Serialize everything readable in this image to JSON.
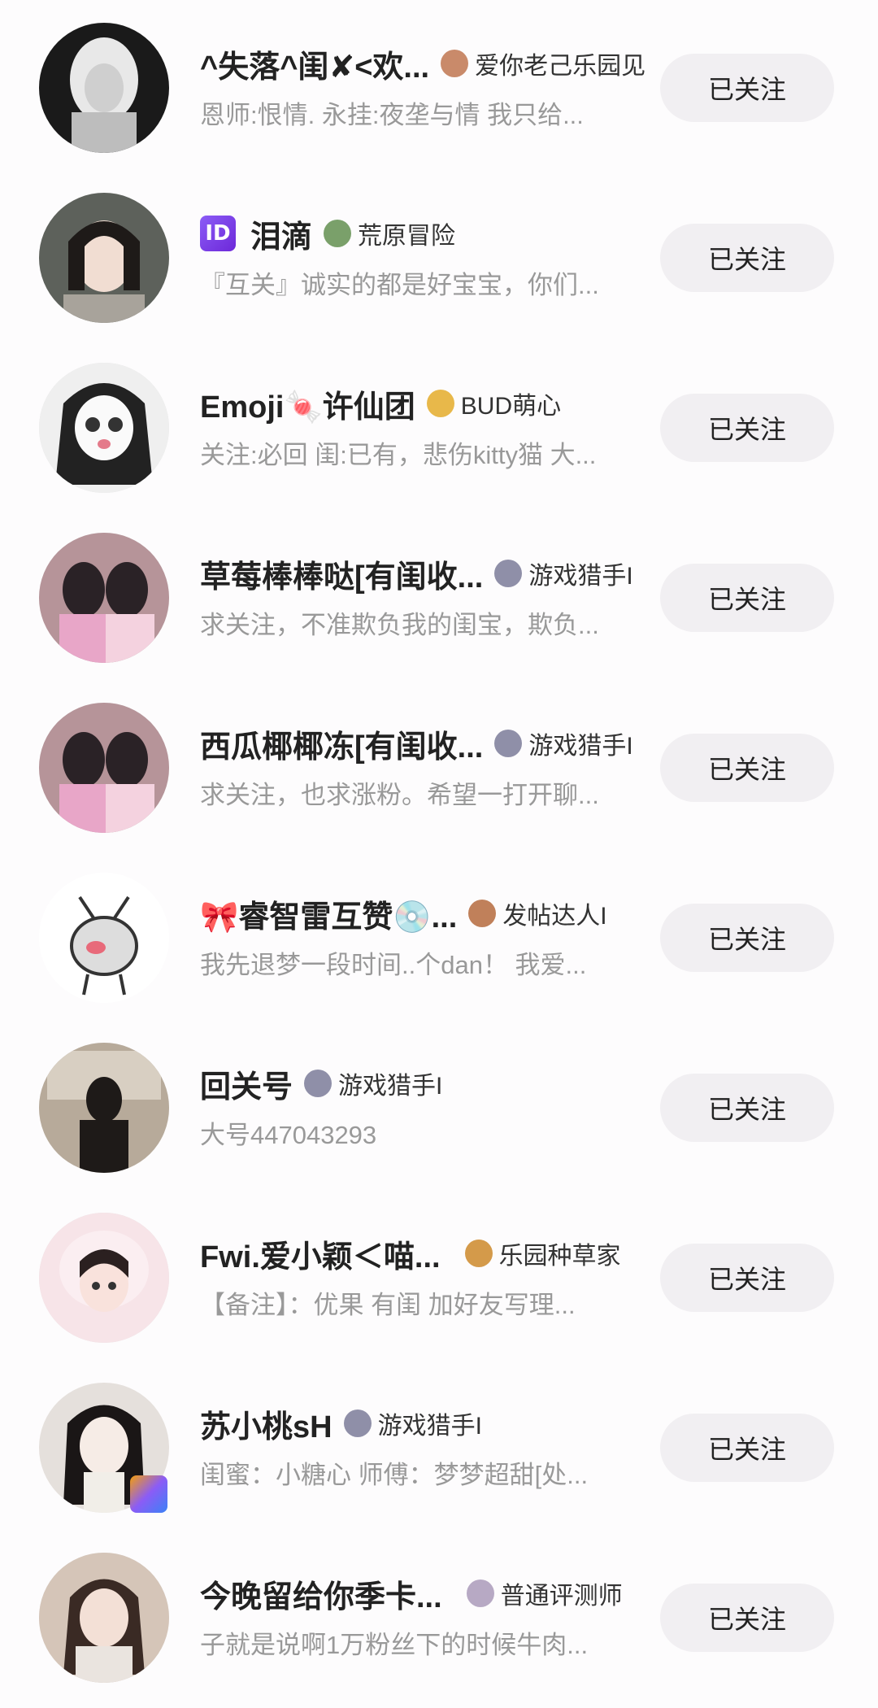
{
  "rows": [
    {
      "name": "^失落^闺✘<欢...",
      "title": "爱你老己乐园见",
      "bio": "恩师:恨情. 永挂:夜垄与情 我只给...",
      "button": "已关注",
      "title_icon": "#c98a6a",
      "avatar": "#2b2b2b"
    },
    {
      "name": "泪滴",
      "prefix": "ID",
      "title": "荒原冒险",
      "bio": "『互关』诚实的都是好宝宝，你们...",
      "button": "已关注",
      "title_icon": "#7aa06a",
      "avatar": "#6b6e68"
    },
    {
      "name": "Emoji🍬许仙团",
      "title": "BUD萌心",
      "bio": "关注:必回 闺:已有，悲伤kitty猫 大...",
      "button": "已关注",
      "title_icon": "#e8b84a",
      "avatar": "#e6e6e6"
    },
    {
      "name": "草莓棒棒哒[有闺收...",
      "title": "游戏猎手I",
      "bio": "求关注，不准欺负我的闺宝，欺负...",
      "button": "已关注",
      "title_icon": "#8f8fa8",
      "avatar": "#c9a2a8"
    },
    {
      "name": "西瓜椰椰冻[有闺收...",
      "title": "游戏猎手I",
      "bio": "求关注，也求涨粉。希望一打开聊...",
      "button": "已关注",
      "title_icon": "#8f8fa8",
      "avatar": "#c9a2a8"
    },
    {
      "name": "🎀睿智雷互赞💿...",
      "title": "发帖达人I",
      "bio": "我先退梦一段时间..个dan！ 我爱...",
      "button": "已关注",
      "title_icon": "#c0805a",
      "avatar": "#ffffff"
    },
    {
      "name": "回关号",
      "title": "游戏猎手I",
      "bio": "大号447043293",
      "button": "已关注",
      "title_icon": "#8f8fa8",
      "avatar": "#a89b8c"
    },
    {
      "name": "Fwi.爱小颖＜喵...",
      "title": "乐园种草家",
      "bio": "【备注】：优果 有闺 加好友写理...",
      "button": "已关注",
      "title_icon": "#d49a4a",
      "avatar": "#f3d6dc"
    },
    {
      "name": "苏小桃sH",
      "title": "游戏猎手I",
      "bio": "闺蜜：小糖心 师傅：梦梦超甜[处...",
      "button": "已关注",
      "title_icon": "#8f8fa8",
      "avatar": "#d9d4d0"
    },
    {
      "name": "今晚留给你季卡...",
      "title": "普通评测师",
      "bio": "子就是说啊1万粉丝下的时候牛肉...",
      "button": "已关注",
      "title_icon": "#b7a9c4",
      "avatar": "#d8c8bd"
    }
  ]
}
